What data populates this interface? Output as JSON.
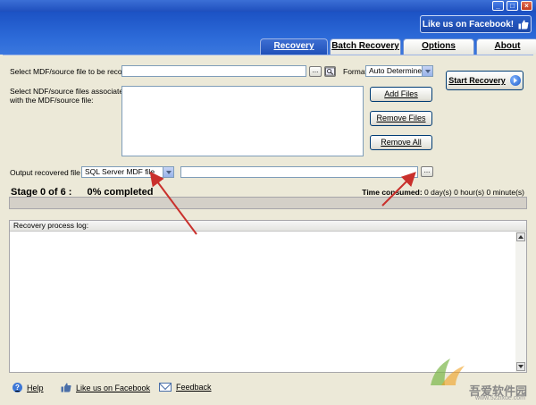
{
  "window": {
    "buttons": [
      "_",
      "□",
      "×"
    ]
  },
  "header": {
    "facebook_label": "Like us on Facebook!",
    "tabs": [
      {
        "label": "Recovery",
        "active": true
      },
      {
        "label": "Batch Recovery",
        "active": false
      },
      {
        "label": "Options",
        "active": false
      },
      {
        "label": "About",
        "active": false
      }
    ]
  },
  "main": {
    "select_source_label": "Select MDF/source file to be recovered:",
    "source_value": "",
    "browse_label": "...",
    "format_label": "Format:",
    "format_value": "Auto Determined",
    "start_label": "Start Recovery",
    "associated_label_1": "Select NDF/source files associated",
    "associated_label_2": "with the MDF/source file:",
    "add_files_label": "Add Files",
    "remove_files_label": "Remove Files",
    "remove_all_label": "Remove All",
    "output_label": "Output recovered file as:",
    "output_type_value": "SQL Server MDF file",
    "output_path_value": "",
    "output_browse_label": "...",
    "stage_label": "Stage 0 of 6 :",
    "percent_label": "0% completed",
    "time_label": "Time consumed:",
    "time_value": "0 day(s) 0 hour(s) 0 minute(s)",
    "progress": 0,
    "log_title": "Recovery process log:"
  },
  "footer": {
    "help_label": "Help",
    "facebook_label": "Like us on Facebook",
    "feedback_label": "Feedback"
  },
  "watermark": {
    "text": "吾爱软件园",
    "url": "www.52zixue.com"
  },
  "colors": {
    "header_blue": "#2c6ad8",
    "arrow_red": "#c9302c"
  }
}
